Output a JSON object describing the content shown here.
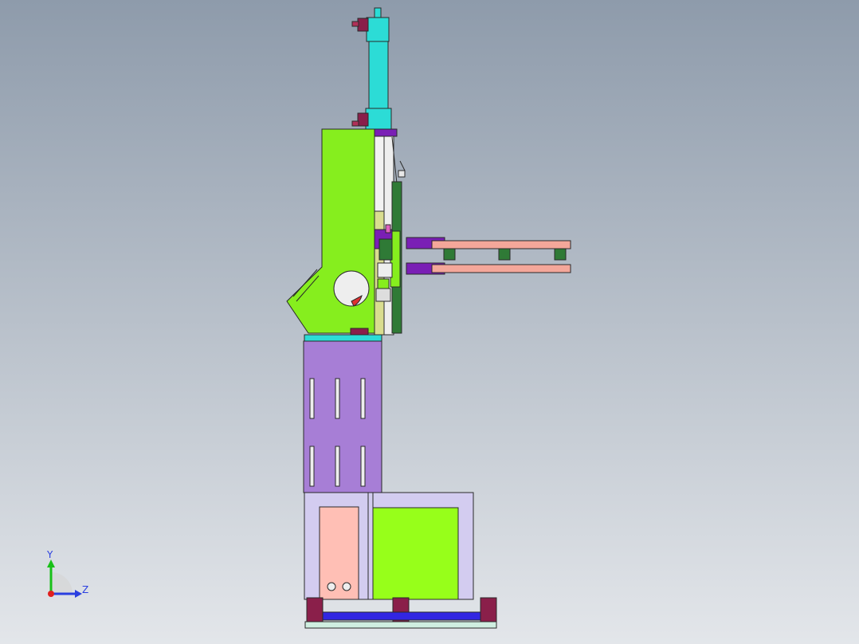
{
  "viewport": {
    "background_top": "#8e9bab",
    "background_bottom": "#e3e6ea",
    "colors": {
      "green": "#86ee1e",
      "lime": "#97ff1a",
      "cyan": "#2cdcd6",
      "purple": "#a77ed6",
      "lavender": "#d3ccf0",
      "salmon": "#f4a79a",
      "pink": "#ffbfb5",
      "violet": "#7a1fb5",
      "blue": "#3226e2",
      "maroon": "#8a1f4a",
      "dark_green": "#2f7a36",
      "mint": "#cfeee0",
      "khaki": "#d9dd8f",
      "red": "#e03030",
      "edge": "#2a2a2a"
    }
  },
  "triad": {
    "y_label": "Y",
    "z_label": "Z",
    "y_color": "#18c018",
    "z_color": "#2a3fe0",
    "x_color": "#e02020"
  }
}
